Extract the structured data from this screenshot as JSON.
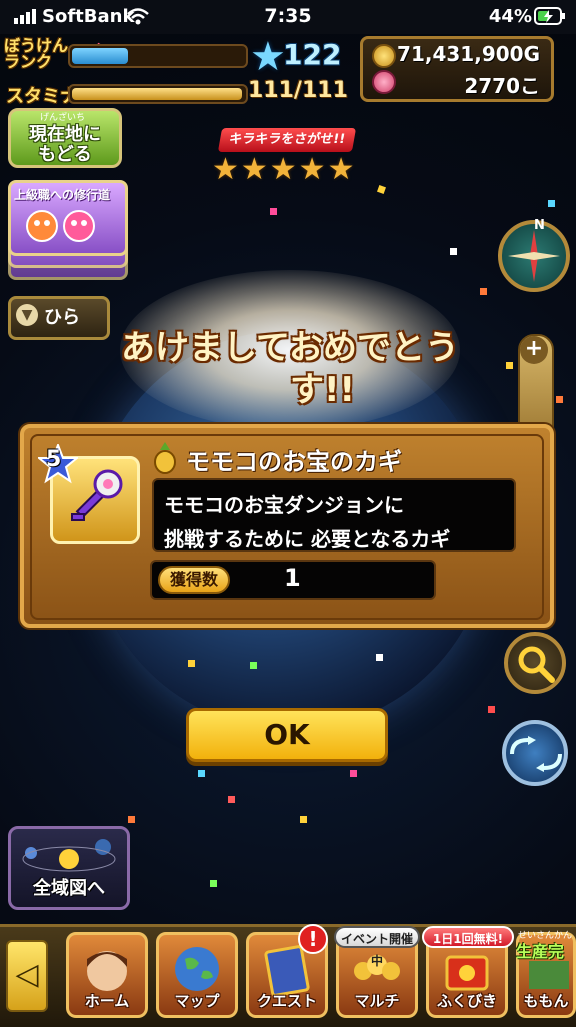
{
  "status_bar": {
    "carrier": "SoftBank",
    "time": "7:35",
    "battery": "44%"
  },
  "hud": {
    "rank_label": "ぼうけんランク",
    "rank_value": "122",
    "rank_progress": 0.33,
    "stamina_label": "スタミナ",
    "stamina_value": "111/111",
    "stamina_progress": 1.0,
    "gold": "71,431,900G",
    "gems": "2770こ"
  },
  "side": {
    "return_label_1": "現在地に",
    "return_label_2": "もどる",
    "return_ruby": "げんざいち",
    "training_title": "上級職への修行道",
    "open_label": "ひら",
    "world_map_label": "全域図へ"
  },
  "event": {
    "kirakira_label": "キラキラをさがせ!!",
    "stars": "★★★★★",
    "banner_1": "あけましておめでとう",
    "banner_2": "す!!"
  },
  "dialog": {
    "rarity": "5",
    "item_name": "モモコのお宝のカギ",
    "description_1": "モモコのお宝ダンジョンに",
    "description_2": "挑戦するために 必要となるカギ",
    "count_label": "獲得数",
    "count_value": "1",
    "ok_label": "OK"
  },
  "nav": {
    "items": [
      {
        "label": "ホーム",
        "icon": "hero-portrait-icon"
      },
      {
        "label": "マップ",
        "icon": "globe-icon"
      },
      {
        "label": "クエスト",
        "icon": "quest-book-icon"
      },
      {
        "label": "マルチ",
        "icon": "multiplayer-icon"
      },
      {
        "label": "ふくびき",
        "icon": "lottery-icon"
      },
      {
        "label": "ももん",
        "icon": "production-icon"
      }
    ],
    "event_badge": "イベント開催中",
    "free_badge": "1日1回無料!",
    "alert_badge": "!",
    "seisan_ruby": "せいさんかんり",
    "seisan_label": "生産完"
  },
  "colors": {
    "accent_gold": "#f2b10c",
    "dialog_brown": "#8a5216",
    "rank_blue": "#7ad8ff"
  }
}
